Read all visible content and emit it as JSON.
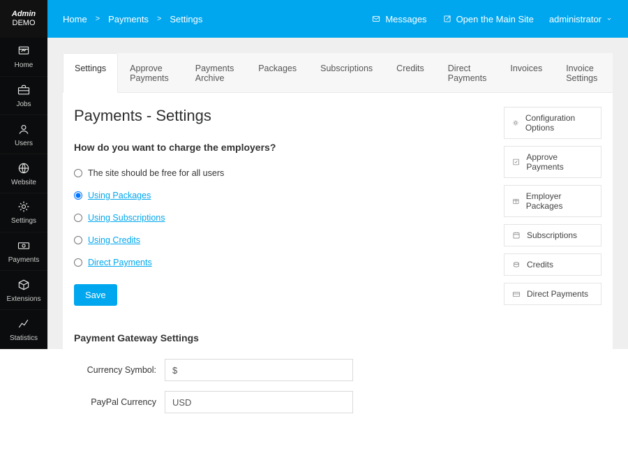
{
  "brand": {
    "line1": "Admin",
    "line2": "DEMO"
  },
  "sidebar": {
    "items": [
      {
        "key": "home",
        "label": "Home"
      },
      {
        "key": "jobs",
        "label": "Jobs"
      },
      {
        "key": "users",
        "label": "Users"
      },
      {
        "key": "website",
        "label": "Website"
      },
      {
        "key": "settings",
        "label": "Settings"
      },
      {
        "key": "payments",
        "label": "Payments"
      },
      {
        "key": "extensions",
        "label": "Extensions"
      },
      {
        "key": "statistics",
        "label": "Statistics"
      }
    ]
  },
  "topbar": {
    "breadcrumbs": [
      "Home",
      "Payments",
      "Settings"
    ],
    "messages": "Messages",
    "open_main_site": "Open the Main Site",
    "user": "administrator"
  },
  "tabs": [
    {
      "label": "Settings",
      "active": true
    },
    {
      "label": "Approve Payments",
      "active": false
    },
    {
      "label": "Payments Archive",
      "active": false
    },
    {
      "label": "Packages",
      "active": false
    },
    {
      "label": "Subscriptions",
      "active": false
    },
    {
      "label": "Credits",
      "active": false
    },
    {
      "label": "Direct Payments",
      "active": false
    },
    {
      "label": "Invoices",
      "active": false
    },
    {
      "label": "Invoice Settings",
      "active": false
    }
  ],
  "title": "Payments - Settings",
  "question": "How do you want to charge the employers?",
  "charge_options": [
    {
      "label": "The site should be free for all users",
      "link": false,
      "selected": false
    },
    {
      "label": "Using Packages",
      "link": true,
      "selected": true
    },
    {
      "label": "Using Subscriptions",
      "link": true,
      "selected": false
    },
    {
      "label": "Using Credits",
      "link": true,
      "selected": false
    },
    {
      "label": "Direct Payments",
      "link": true,
      "selected": false
    }
  ],
  "save_label": "Save",
  "gateway_heading": "Payment Gateway Settings",
  "fields": {
    "currency_symbol": {
      "label": "Currency Symbol:",
      "value": "$"
    },
    "paypal_currency": {
      "label": "PayPal Currency",
      "value": "USD"
    }
  },
  "side_links": [
    {
      "icon": "gear",
      "label": "Configuration Options"
    },
    {
      "icon": "approve",
      "label": "Approve Payments"
    },
    {
      "icon": "package",
      "label": "Employer Packages"
    },
    {
      "icon": "calendar",
      "label": "Subscriptions"
    },
    {
      "icon": "credits",
      "label": "Credits"
    },
    {
      "icon": "direct",
      "label": "Direct Payments"
    }
  ]
}
